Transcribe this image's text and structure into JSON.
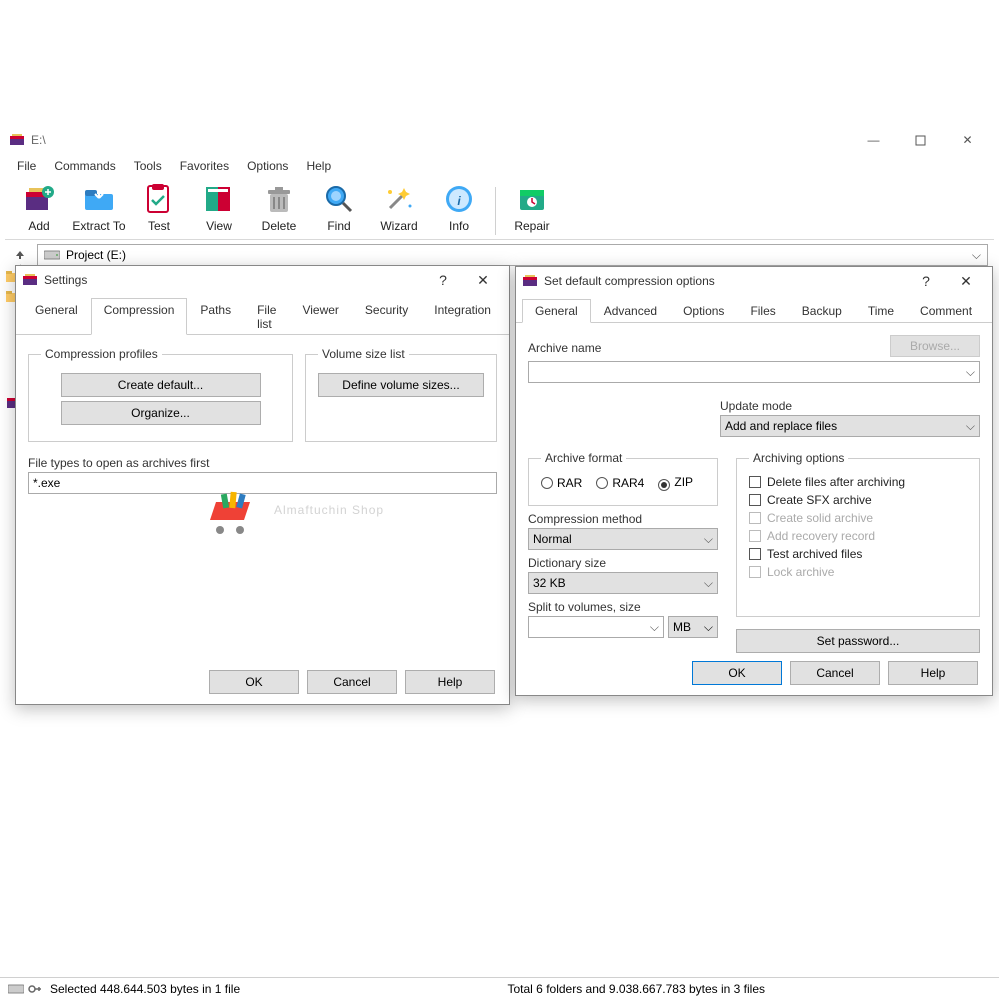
{
  "window": {
    "title": "E:\\",
    "menus": [
      "File",
      "Commands",
      "Tools",
      "Favorites",
      "Options",
      "Help"
    ],
    "toolbar": [
      {
        "label": "Add",
        "icon": "add-archive"
      },
      {
        "label": "Extract To",
        "icon": "extract"
      },
      {
        "label": "Test",
        "icon": "test"
      },
      {
        "label": "View",
        "icon": "view"
      },
      {
        "label": "Delete",
        "icon": "delete"
      },
      {
        "label": "Find",
        "icon": "find"
      },
      {
        "label": "Wizard",
        "icon": "wizard"
      },
      {
        "label": "Info",
        "icon": "info"
      }
    ],
    "toolbar_after_sep": [
      {
        "label": "Repair",
        "icon": "repair"
      }
    ],
    "path": "Project (E:)",
    "status_left": "Selected 448.644.503 bytes in 1 file",
    "status_right": "Total 6 folders and 9.038.667.783 bytes in 3 files"
  },
  "settings_dialog": {
    "title": "Settings",
    "tabs": [
      "General",
      "Compression",
      "Paths",
      "File list",
      "Viewer",
      "Security",
      "Integration"
    ],
    "active_tab_index": 1,
    "compression_profiles_legend": "Compression profiles",
    "btn_create_default": "Create default...",
    "btn_organize": "Organize...",
    "volume_size_legend": "Volume size list",
    "btn_define_volume": "Define volume sizes...",
    "file_types_label": "File types to open as archives first",
    "file_types_value": "*.exe",
    "ok": "OK",
    "cancel": "Cancel",
    "help": "Help"
  },
  "comp_dialog": {
    "title": "Set default compression options",
    "tabs": [
      "General",
      "Advanced",
      "Options",
      "Files",
      "Backup",
      "Time",
      "Comment"
    ],
    "active_tab_index": 0,
    "archive_name_label": "Archive name",
    "browse": "Browse...",
    "archive_name_value": "",
    "update_mode_label": "Update mode",
    "update_mode_value": "Add and replace files",
    "archive_format_legend": "Archive format",
    "fmt_rar": "RAR",
    "fmt_rar4": "RAR4",
    "fmt_zip": "ZIP",
    "compression_method_label": "Compression method",
    "compression_method_value": "Normal",
    "dictionary_label": "Dictionary size",
    "dictionary_value": "32 KB",
    "split_label": "Split to volumes, size",
    "split_unit": "MB",
    "arch_options_legend": "Archiving options",
    "opt_delete": "Delete files after archiving",
    "opt_sfx": "Create SFX archive",
    "opt_solid": "Create solid archive",
    "opt_recovery": "Add recovery record",
    "opt_test": "Test archived files",
    "opt_lock": "Lock archive",
    "set_password": "Set password...",
    "ok": "OK",
    "cancel": "Cancel",
    "help": "Help"
  },
  "watermark": "Almaftuchin Shop",
  "icon_svgs": {}
}
